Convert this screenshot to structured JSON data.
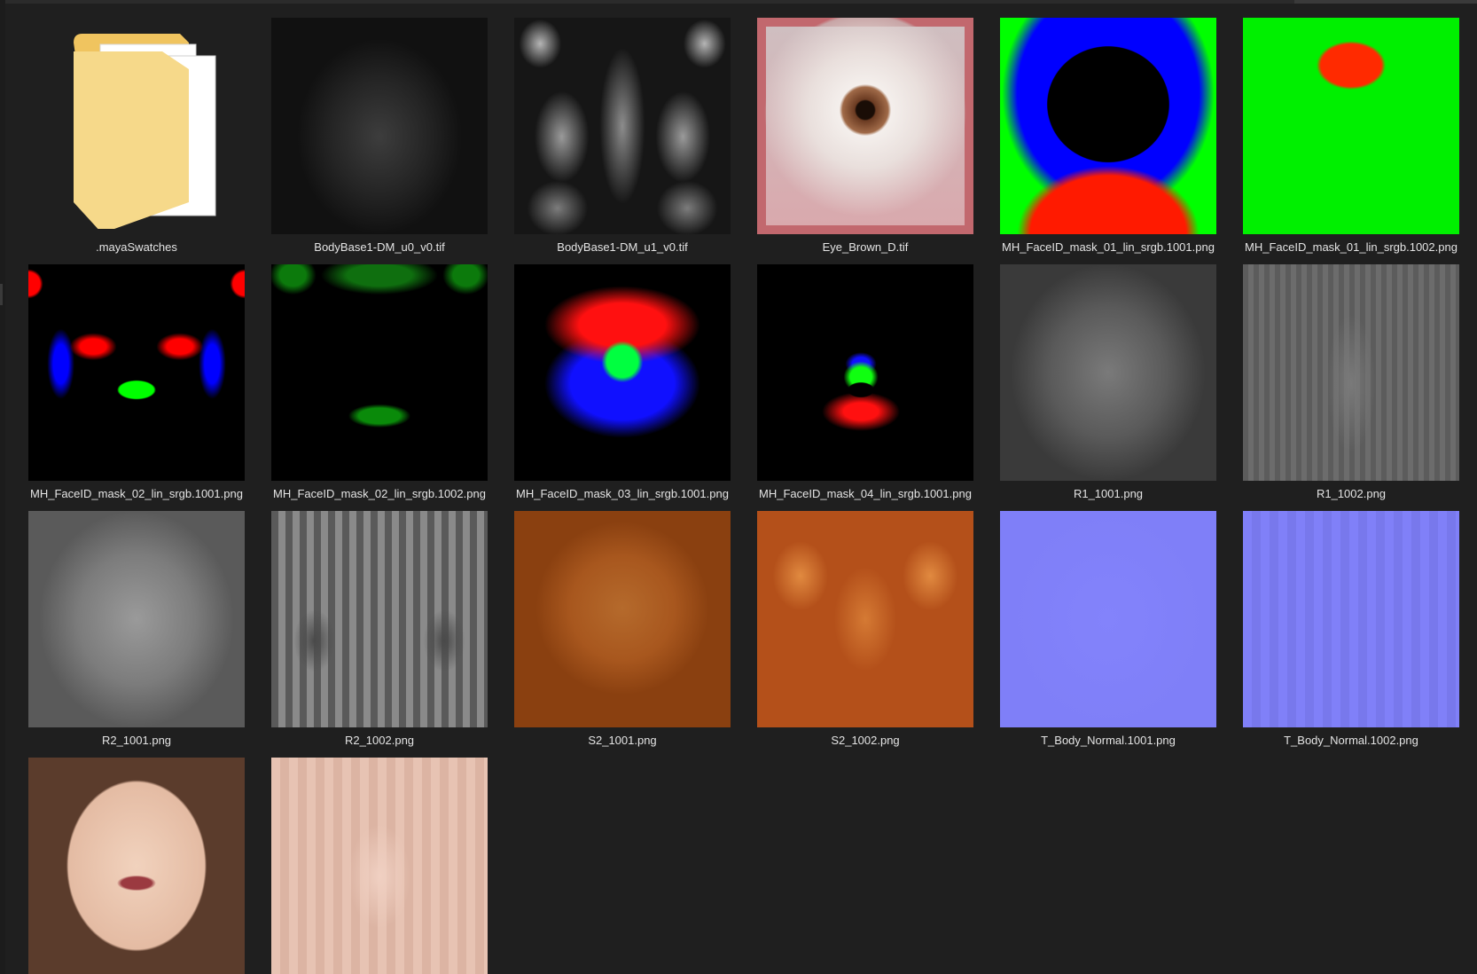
{
  "files": [
    {
      "name": ".mayaSwatches",
      "kind": "folder",
      "icon": "folder-icon",
      "thumb": "folder"
    },
    {
      "name": "BodyBase1-DM_u0_v0.tif",
      "kind": "image",
      "thumb": "t-bodybase0"
    },
    {
      "name": "BodyBase1-DM_u1_v0.tif",
      "kind": "image",
      "thumb": "t-bodybase1"
    },
    {
      "name": "Eye_Brown_D.tif",
      "kind": "image",
      "thumb": "t-eye"
    },
    {
      "name": "MH_FaceID_mask_01_lin_srgb.1001.png",
      "kind": "image",
      "thumb": "t-mask01a"
    },
    {
      "name": "MH_FaceID_mask_01_lin_srgb.1002.png",
      "kind": "image",
      "thumb": "t-mask01b"
    },
    {
      "name": "MH_FaceID_mask_02_lin_srgb.1001.png",
      "kind": "image",
      "thumb": "t-mask02a"
    },
    {
      "name": "MH_FaceID_mask_02_lin_srgb.1002.png",
      "kind": "image",
      "thumb": "t-mask02b"
    },
    {
      "name": "MH_FaceID_mask_03_lin_srgb.1001.png",
      "kind": "image",
      "thumb": "t-mask03"
    },
    {
      "name": "MH_FaceID_mask_04_lin_srgb.1001.png",
      "kind": "image",
      "thumb": "t-mask04"
    },
    {
      "name": "R1_1001.png",
      "kind": "image",
      "thumb": "t-r1a"
    },
    {
      "name": "R1_1002.png",
      "kind": "image",
      "thumb": "t-r1b"
    },
    {
      "name": "R2_1001.png",
      "kind": "image",
      "thumb": "t-r2a"
    },
    {
      "name": "R2_1002.png",
      "kind": "image",
      "thumb": "t-r2b"
    },
    {
      "name": "S2_1001.png",
      "kind": "image",
      "thumb": "t-s2a"
    },
    {
      "name": "S2_1002.png",
      "kind": "image",
      "thumb": "t-s2b"
    },
    {
      "name": "T_Body_Normal.1001.png",
      "kind": "image",
      "thumb": "t-na"
    },
    {
      "name": "T_Body_Normal.1002.png",
      "kind": "image",
      "thumb": "t-nb"
    },
    {
      "name": "",
      "kind": "image",
      "thumb": "t-ca"
    },
    {
      "name": "",
      "kind": "image",
      "thumb": "t-cb"
    }
  ],
  "colors": {
    "background": "#1f1f1f",
    "label_text": "#e4e4e4",
    "folder_yellow": "#f3cd6a",
    "paper_white": "#ffffff"
  }
}
